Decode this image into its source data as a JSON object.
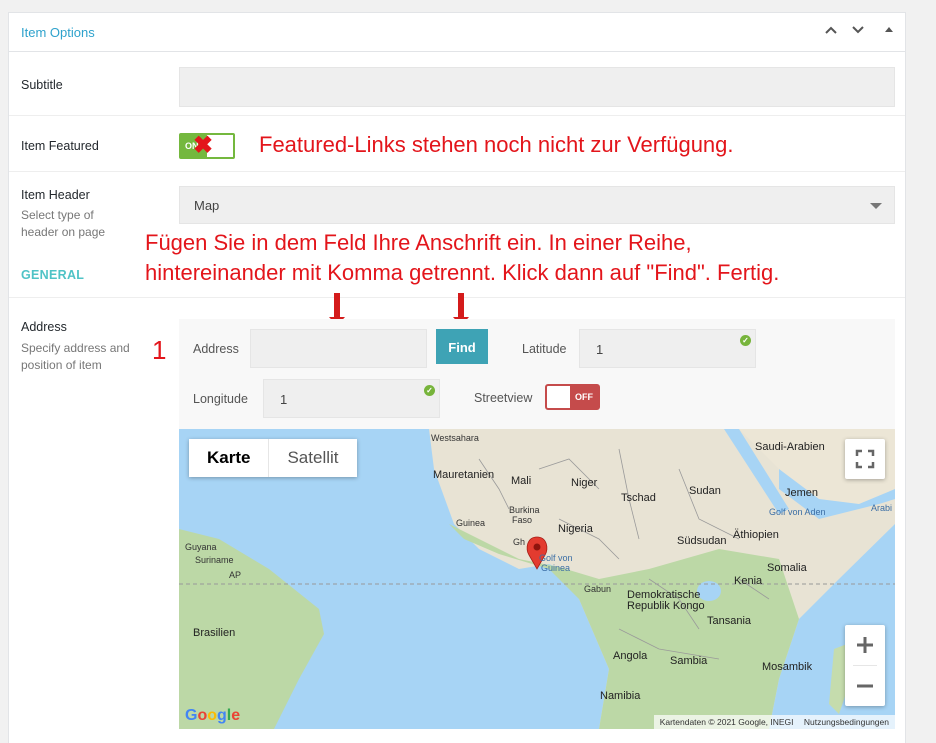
{
  "panel": {
    "title": "Item Options",
    "controls": [
      "chevron-up-icon",
      "chevron-down-icon",
      "caret-up-icon"
    ]
  },
  "subtitle": {
    "label": "Subtitle",
    "value": ""
  },
  "featured": {
    "label": "Item Featured",
    "toggle_text": "ON",
    "note": "Featured-Links stehen noch nicht zur Verfügung."
  },
  "header": {
    "label": "Item Header",
    "description": "Select type of header on page",
    "selected": "Map"
  },
  "instruction": {
    "line1": "Fügen Sie in dem Feld Ihre Anschrift ein. In einer Reihe,",
    "line2": "hintereinander mit Komma getrennt. Klick dann auf \"Find\". Fertig."
  },
  "section": {
    "title": "GENERAL"
  },
  "address": {
    "label": "Address",
    "description": "Specify address and position of item",
    "marker": "1",
    "address_label": "Address",
    "address_value": "",
    "find_label": "Find",
    "latitude_label": "Latitude",
    "latitude_value": "1",
    "longitude_label": "Longitude",
    "longitude_value": "1",
    "streetview_label": "Streetview",
    "streetview_toggle": "OFF"
  },
  "map": {
    "type_map": "Karte",
    "type_satellite": "Satellit",
    "footer_data": "Kartendaten © 2021 Google, INEGI",
    "footer_terms": "Nutzungsbedingungen",
    "logo": "Google",
    "labels": {
      "westsahara": "Westsahara",
      "mauretanien": "Mauretanien",
      "mali": "Mali",
      "niger": "Niger",
      "tschad": "Tschad",
      "sudan": "Sudan",
      "saudi": "Saudi-Arabien",
      "jemen": "Jemen",
      "golf_aden": "Golf von Aden",
      "arabi": "Arabi",
      "guinea": "Guinea",
      "burkina": "Burkina",
      "faso": "Faso",
      "nigeria": "Nigeria",
      "ghana": "Gh",
      "golf_guinea1": "Golf von",
      "golf_guinea2": "Guinea",
      "suedsudan": "Südsudan",
      "aethiopien": "Äthiopien",
      "somalia": "Somalia",
      "kenia": "Kenia",
      "gabun": "Gabun",
      "kongo1": "Demokratische",
      "kongo2": "Republik Kongo",
      "tansania": "Tansania",
      "angola": "Angola",
      "sambia": "Sambia",
      "mosambik": "Mosambik",
      "namibia": "Namibia",
      "guyana": "Guyana",
      "suriname": "Suriname",
      "ap": "AP",
      "brasilien": "Brasilien"
    }
  }
}
